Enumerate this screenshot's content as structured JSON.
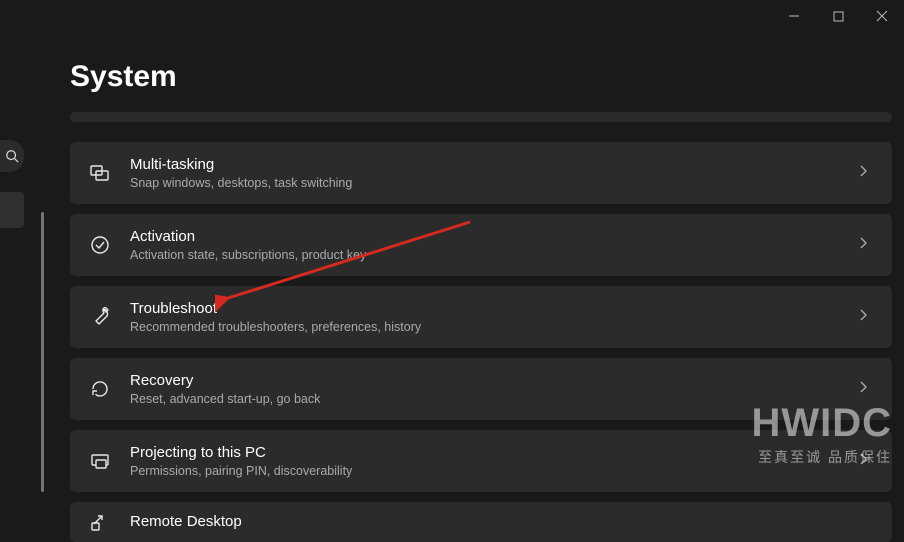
{
  "page": {
    "title": "System"
  },
  "cards": {
    "multitasking": {
      "title": "Multi-tasking",
      "desc": "Snap windows, desktops, task switching"
    },
    "activation": {
      "title": "Activation",
      "desc": "Activation state, subscriptions, product key"
    },
    "troubleshoot": {
      "title": "Troubleshoot",
      "desc": "Recommended troubleshooters, preferences, history"
    },
    "recovery": {
      "title": "Recovery",
      "desc": "Reset, advanced start-up, go back"
    },
    "projecting": {
      "title": "Projecting to this PC",
      "desc": "Permissions, pairing PIN, discoverability"
    },
    "remotedesktop": {
      "title": "Remote Desktop",
      "desc": ""
    }
  },
  "watermark": {
    "brand": "HWIDC",
    "tagline": "至真至诚 品质保住"
  },
  "annotation": {
    "arrow_target": "troubleshoot",
    "color": "#d42a1f"
  }
}
